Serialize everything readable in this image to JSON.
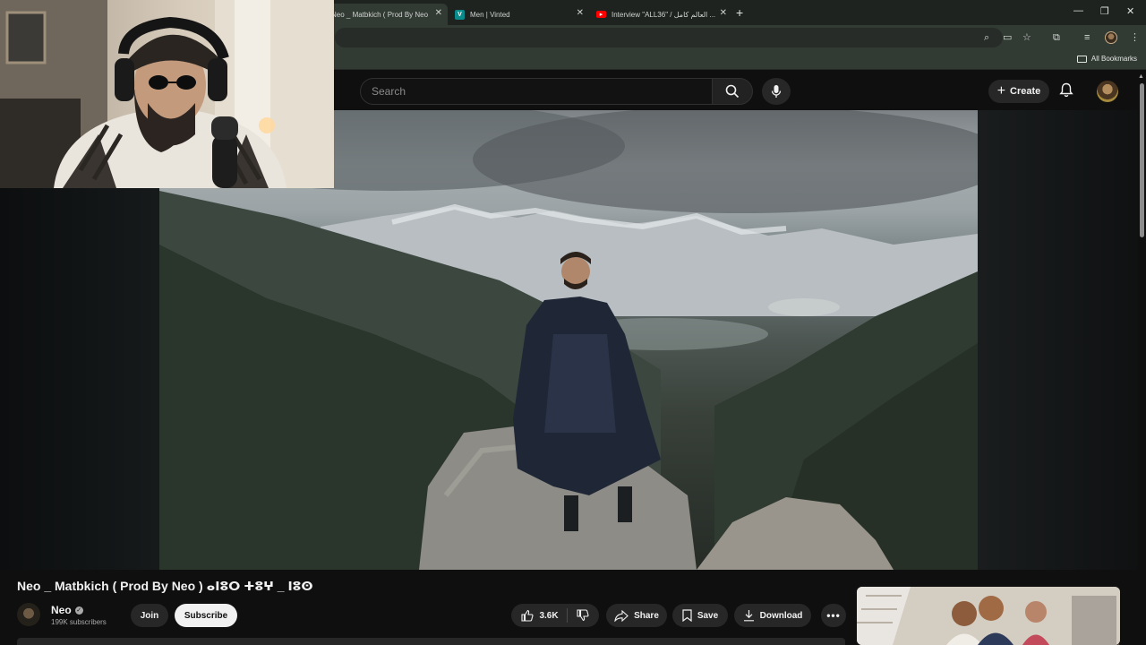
{
  "browser": {
    "tabs": [
      {
        "title": "Neo _ Matbkich ( Prod By Neo",
        "favicon": "youtube-favicon",
        "active": true
      },
      {
        "title": "Men | Vinted",
        "favicon": "vinted-favicon",
        "favicon_letter": "V",
        "active": false
      },
      {
        "title": "Interview \"ALL36\" / العالم كامل ...",
        "favicon": "youtube-favicon",
        "active": false
      }
    ],
    "new_tab_icon": "plus-icon",
    "bookmarks_bar": {
      "all_bookmarks_label": "All Bookmarks"
    },
    "colors": {
      "tabbar": "#1f2320",
      "toolbar": "#323a34"
    }
  },
  "youtube": {
    "search": {
      "placeholder": "Search"
    },
    "create_label": "Create",
    "accent_red": "#ff0000"
  },
  "video": {
    "title": "Neo _ Matbkich ( Prod By Neo ) ⴰⵏⵓⵔ ⵜⵓⵖ _ ⵏⵓⵙ",
    "channel": {
      "name": "Neo",
      "verified": true,
      "subscribers": "199K subscribers"
    },
    "buttons": {
      "join": "Join",
      "subscribe": "Subscribe",
      "likes": "3.6K",
      "share": "Share",
      "save": "Save",
      "download": "Download"
    }
  }
}
